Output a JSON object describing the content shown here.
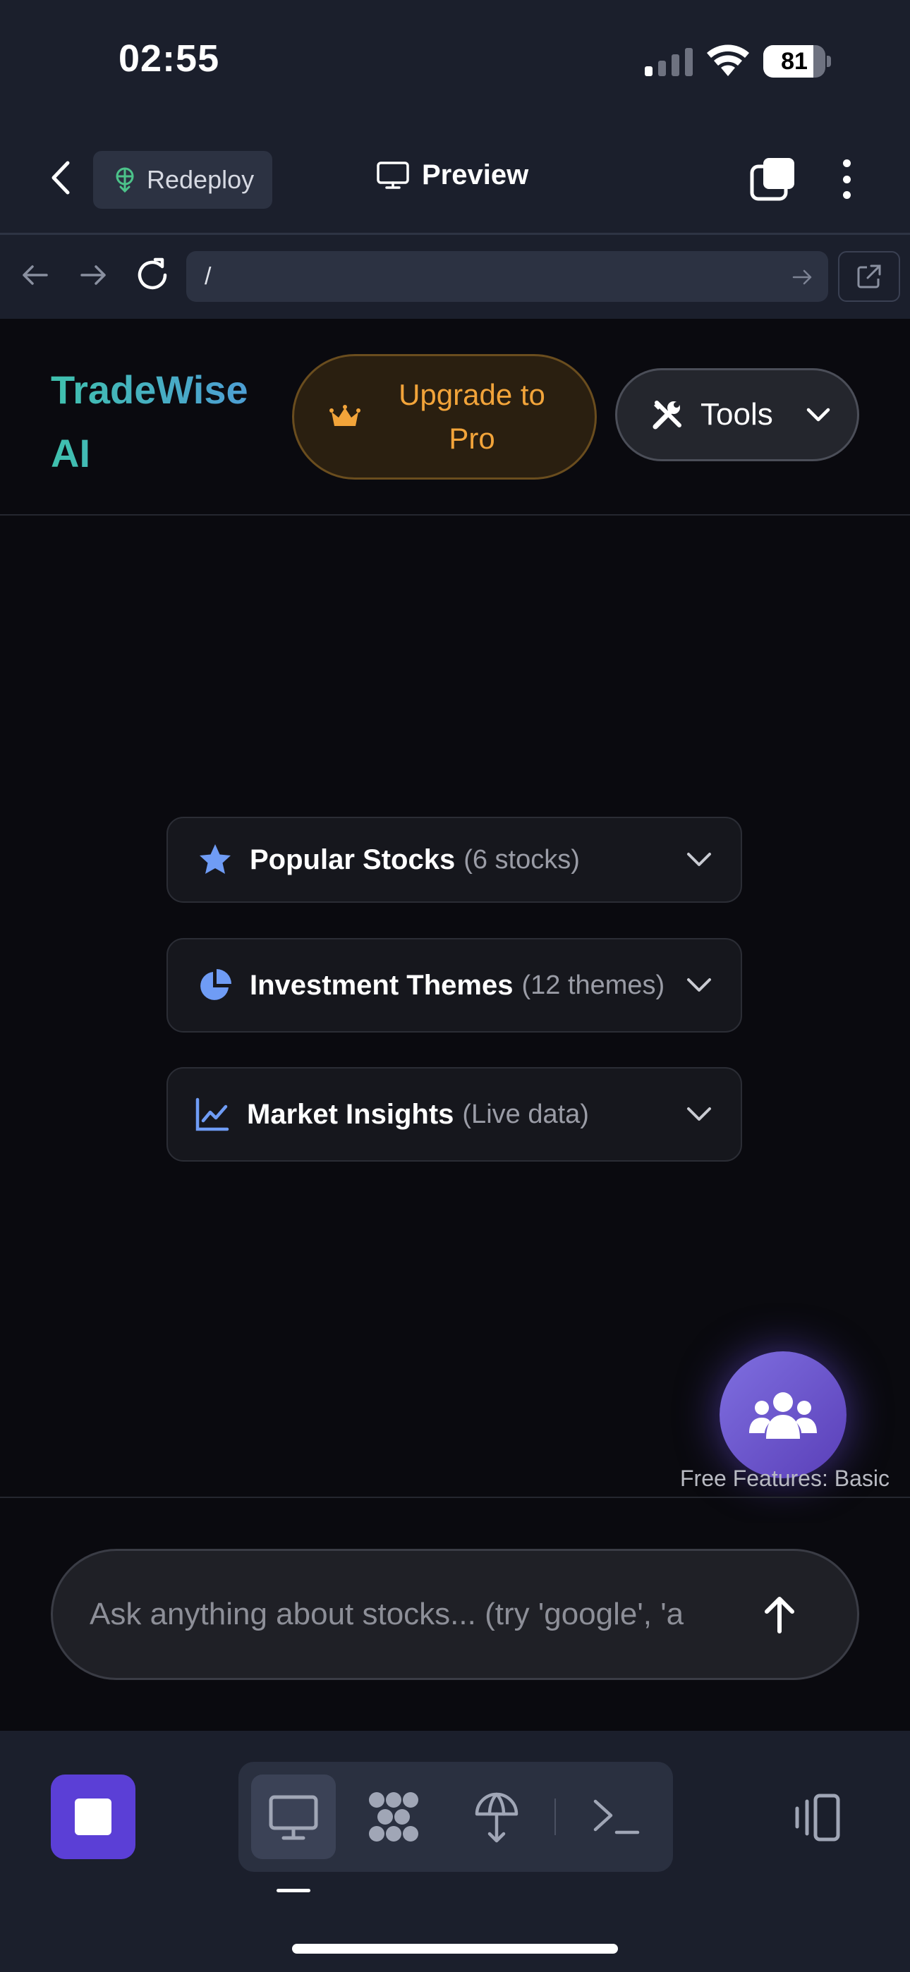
{
  "status_bar": {
    "time": "02:55",
    "battery": "81",
    "battery_level": 0.81
  },
  "header": {
    "redeploy_label": "Redeploy",
    "preview_label": "Preview"
  },
  "browser": {
    "url": "/"
  },
  "web": {
    "brand_line1": "TradeWise",
    "brand_line2": "AI",
    "upgrade_line1": "Upgrade to",
    "upgrade_line2": "Pro",
    "tools_label": "Tools",
    "sections": [
      {
        "title": "Popular Stocks",
        "sub": "(6 stocks)",
        "icon": "star-icon"
      },
      {
        "title": "Investment Themes",
        "sub": "(12 themes)",
        "icon": "pie-chart-icon"
      },
      {
        "title": "Market Insights",
        "sub": "(Live data)",
        "icon": "line-chart-icon"
      }
    ],
    "free_features": "Free Features: Basic",
    "chat_placeholder": "Ask anything about stocks... (try 'google', 'a"
  },
  "colors": {
    "accent": "#5b3fd6",
    "upgrade": "#f2a43a",
    "brand_start": "#3fc1ad",
    "brand_end": "#4f9ad8"
  }
}
